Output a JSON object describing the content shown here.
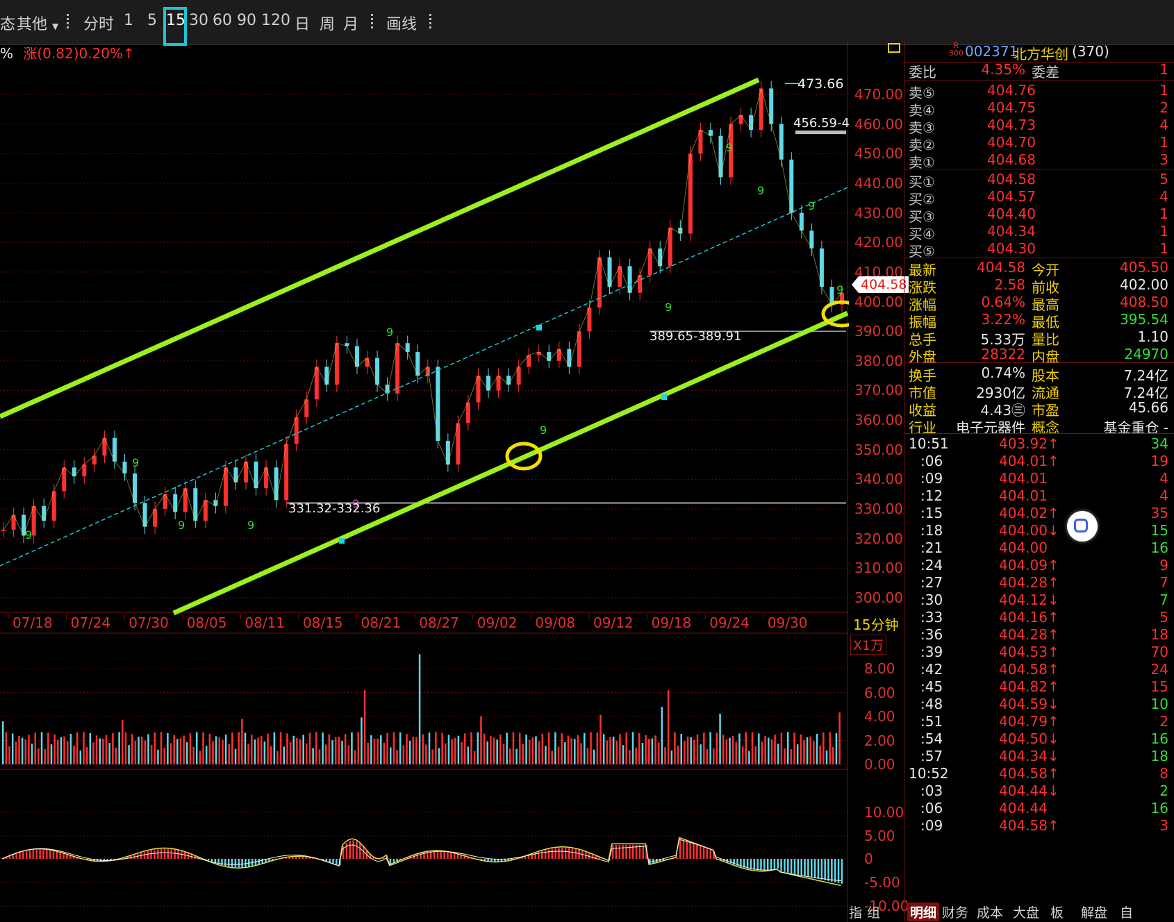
{
  "toolbar": {
    "items": [
      "态",
      "其他",
      "分时",
      "1",
      "5",
      "15",
      "30",
      "60",
      "90",
      "120",
      "日",
      "周",
      "月",
      "画线"
    ],
    "selected": "15"
  },
  "header": {
    "left_text": "%",
    "change_text": "涨(0.82)0.20%↑"
  },
  "chart_data": [
    {
      "type": "line",
      "title": "",
      "period_label": "15分钟",
      "x_ticks": [
        "07/18",
        "07/24",
        "07/30",
        "08/05",
        "08/11",
        "08/15",
        "08/21",
        "08/27",
        "09/02",
        "09/08",
        "09/12",
        "09/18",
        "09/24",
        "09/30"
      ],
      "y_ticks": [
        "470.00",
        "460.00",
        "450.00",
        "440.00",
        "430.00",
        "420.00",
        "410.00",
        "400.00",
        "390.00",
        "380.00",
        "370.00",
        "360.00",
        "350.00",
        "340.00",
        "330.00",
        "320.00",
        "310.00",
        "300.00"
      ],
      "ylim": [
        294,
        476
      ],
      "last_price_tag": "404.58",
      "annotations": [
        "473.66",
        "456.59-4",
        "389.65-389.91",
        "331.32-332.36"
      ],
      "series": [
        {
          "values": [
            323,
            328,
            321,
            331,
            326,
            336,
            344,
            341,
            345,
            348,
            354,
            346,
            342,
            332,
            324,
            330,
            335,
            329,
            337,
            326,
            333,
            331,
            344,
            339,
            346,
            337,
            344,
            333,
            352,
            361,
            367,
            378,
            372,
            386,
            385,
            378,
            381,
            372,
            369,
            386,
            383,
            375,
            378,
            353,
            345,
            359,
            366,
            375,
            370,
            375,
            372,
            378,
            382,
            383,
            380,
            384,
            378,
            390,
            398,
            415,
            405,
            412,
            403,
            409,
            418,
            412,
            425,
            423,
            450,
            458,
            456,
            442,
            460,
            463,
            458,
            472,
            460,
            448,
            430,
            424,
            418,
            405,
            399,
            403
          ]
        }
      ],
      "channel": {
        "upper_start": 384,
        "upper_end": 500,
        "mid_start": 314,
        "mid_end": 437,
        "lower_start": 250,
        "lower_end": 393
      }
    },
    {
      "type": "bar",
      "title": "",
      "unit_label": "X1万",
      "y_ticks": [
        "8.00",
        "6.00",
        "4.00",
        "2.00",
        "0.00"
      ],
      "ylim": [
        0,
        10
      ]
    },
    {
      "type": "bar",
      "title": "",
      "y_ticks": [
        "10.00",
        "5.00",
        "0",
        "-5.00",
        "-10.00"
      ],
      "ylim": [
        -10.5,
        14
      ]
    }
  ],
  "quote": {
    "badge": "R\n300",
    "code": "002371",
    "name": "北方华创",
    "count": "(370)",
    "ratio_label": "委比",
    "ratio_value": "4.35%",
    "diff_label": "委差",
    "diff_value": "1",
    "asks": [
      {
        "label": "卖⑤",
        "price": "404.76",
        "vol": "1"
      },
      {
        "label": "卖④",
        "price": "404.75",
        "vol": "2"
      },
      {
        "label": "卖③",
        "price": "404.73",
        "vol": "4"
      },
      {
        "label": "卖②",
        "price": "404.70",
        "vol": "1"
      },
      {
        "label": "卖①",
        "price": "404.68",
        "vol": "3"
      }
    ],
    "bids": [
      {
        "label": "买①",
        "price": "404.58",
        "vol": "5"
      },
      {
        "label": "买②",
        "price": "404.57",
        "vol": "4"
      },
      {
        "label": "买③",
        "price": "404.40",
        "vol": "1"
      },
      {
        "label": "买④",
        "price": "404.34",
        "vol": "1"
      },
      {
        "label": "买⑤",
        "price": "404.30",
        "vol": "1"
      }
    ],
    "stats": [
      {
        "l1": "最新",
        "v1": "404.58",
        "l2": "今开",
        "v2": "405.50",
        "c1": "red",
        "c2": "red"
      },
      {
        "l1": "涨跌",
        "v1": "2.58",
        "l2": "前收",
        "v2": "402.00",
        "c1": "red",
        "c2": "white"
      },
      {
        "l1": "涨幅",
        "v1": "0.64%",
        "l2": "最高",
        "v2": "408.50",
        "c1": "red",
        "c2": "red"
      },
      {
        "l1": "振幅",
        "v1": "3.22%",
        "l2": "最低",
        "v2": "395.54",
        "c1": "red",
        "c2": "green"
      },
      {
        "l1": "总手",
        "v1": "5.33万",
        "l2": "量比",
        "v2": "1.10",
        "c1": "white",
        "c2": "white"
      },
      {
        "l1": "外盘",
        "v1": "28322",
        "l2": "内盘",
        "v2": "24970",
        "c1": "red",
        "c2": "green"
      }
    ],
    "info": [
      {
        "l1": "换手",
        "v1": "0.74%",
        "l2": "股本",
        "v2": "7.24亿"
      },
      {
        "l1": "市值",
        "v1": "2930亿",
        "l2": "流通",
        "v2": "7.24亿"
      },
      {
        "l1": "收益",
        "v1": "4.43㊂",
        "l2": "市盈",
        "v2": "45.66"
      },
      {
        "l1": "行业",
        "v1": "电子元器件",
        "l2": "概念",
        "v2": "基金重仓 -"
      }
    ]
  },
  "ticks": [
    {
      "t": "10:51",
      "p": "403.92↑",
      "v": "34",
      "pc": "red",
      "vc": "green"
    },
    {
      "t": ":06",
      "p": "404.01↑",
      "v": "19",
      "pc": "red",
      "vc": "red"
    },
    {
      "t": ":09",
      "p": "404.01",
      "v": "4",
      "pc": "red",
      "vc": "red"
    },
    {
      "t": ":12",
      "p": "404.01",
      "v": "4",
      "pc": "red",
      "vc": "red"
    },
    {
      "t": ":15",
      "p": "404.02↑",
      "v": "35",
      "pc": "red",
      "vc": "red"
    },
    {
      "t": ":18",
      "p": "404.00↓",
      "v": "15",
      "pc": "red",
      "vc": "green"
    },
    {
      "t": ":21",
      "p": "404.00",
      "v": "16",
      "pc": "red",
      "vc": "green"
    },
    {
      "t": ":24",
      "p": "404.09↑",
      "v": "9",
      "pc": "red",
      "vc": "red"
    },
    {
      "t": ":27",
      "p": "404.28↑",
      "v": "7",
      "pc": "red",
      "vc": "red"
    },
    {
      "t": ":30",
      "p": "404.12↓",
      "v": "7",
      "pc": "red",
      "vc": "green"
    },
    {
      "t": ":33",
      "p": "404.16↑",
      "v": "5",
      "pc": "red",
      "vc": "red"
    },
    {
      "t": ":36",
      "p": "404.28↑",
      "v": "18",
      "pc": "red",
      "vc": "red"
    },
    {
      "t": ":39",
      "p": "404.53↑",
      "v": "70",
      "pc": "red",
      "vc": "red"
    },
    {
      "t": ":42",
      "p": "404.58↑",
      "v": "24",
      "pc": "red",
      "vc": "red"
    },
    {
      "t": ":45",
      "p": "404.82↑",
      "v": "15",
      "pc": "red",
      "vc": "red"
    },
    {
      "t": ":48",
      "p": "404.59↓",
      "v": "10",
      "pc": "red",
      "vc": "green"
    },
    {
      "t": ":51",
      "p": "404.79↑",
      "v": "2",
      "pc": "red",
      "vc": "red"
    },
    {
      "t": ":54",
      "p": "404.50↓",
      "v": "16",
      "pc": "red",
      "vc": "green"
    },
    {
      "t": ":57",
      "p": "404.34↓",
      "v": "18",
      "pc": "red",
      "vc": "green"
    },
    {
      "t": "10:52",
      "p": "404.58↑",
      "v": "8",
      "pc": "red",
      "vc": "red"
    },
    {
      "t": ":03",
      "p": "404.44↓",
      "v": "2",
      "pc": "red",
      "vc": "green"
    },
    {
      "t": ":06",
      "p": "404.44",
      "v": "16",
      "pc": "red",
      "vc": "green"
    },
    {
      "t": ":09",
      "p": "404.58↑",
      "v": "3",
      "pc": "red",
      "vc": "red"
    }
  ],
  "bottom_tabs": [
    "指",
    "组",
    "明细",
    "财务",
    "成本",
    "大盘",
    "板",
    "解盘",
    "自"
  ],
  "colors": {
    "up": "#ff3030",
    "down": "#30e030",
    "channel": "#9cf020",
    "highlight_ring": "#f0e000",
    "mid_line": "#18c8d8"
  }
}
